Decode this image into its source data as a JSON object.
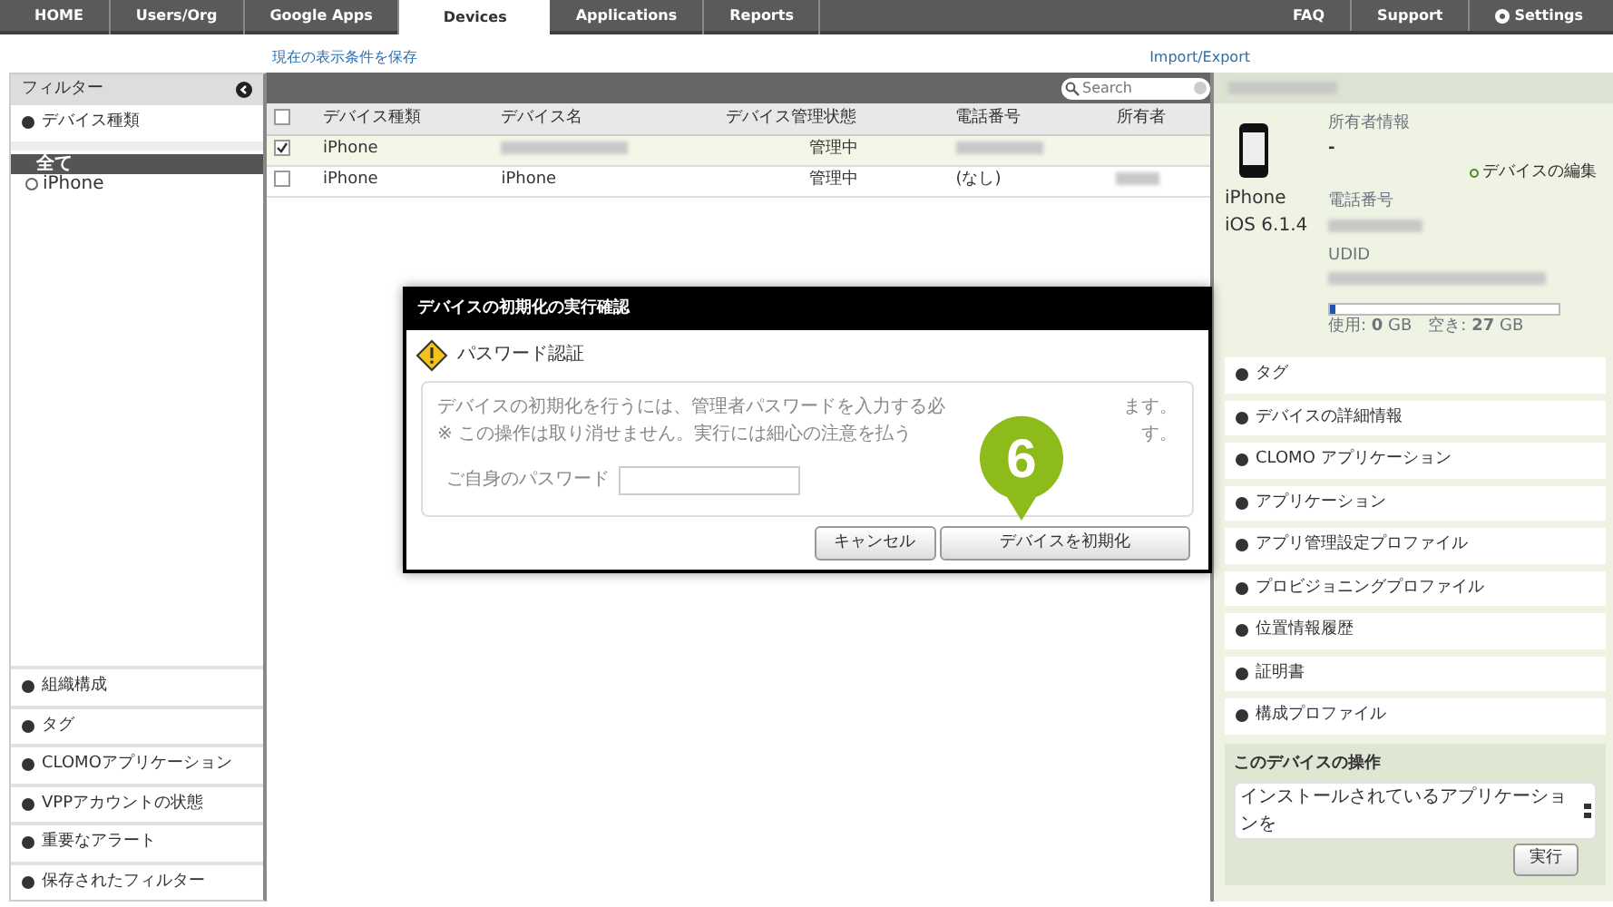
{
  "top_nav": {
    "tabs": [
      {
        "label": "HOME",
        "selected": false
      },
      {
        "label": "Users/Org",
        "selected": false
      },
      {
        "label": "Google Apps",
        "selected": false
      },
      {
        "label": "Devices",
        "selected": true
      },
      {
        "label": "Applications",
        "selected": false
      },
      {
        "label": "Reports",
        "selected": false
      }
    ],
    "right_links": [
      "FAQ",
      "Support",
      "Settings"
    ]
  },
  "links": {
    "save_filter": "現在の表示条件を保存",
    "import_export": "Import/Export"
  },
  "filter_panel": {
    "title": "フィルター",
    "section": "デバイス種類",
    "options": [
      {
        "label": "全て",
        "selected": true
      },
      {
        "label": "iPhone",
        "selected": false
      }
    ],
    "bottom_sections": [
      "組織構成",
      "タグ",
      "CLOMOアプリケーション",
      "VPPアカウントの状態",
      "重要なアラート",
      "保存されたフィルター"
    ]
  },
  "device_table": {
    "search_placeholder": "Search",
    "select_all_checked": false,
    "columns": [
      "デバイス種類",
      "デバイス名",
      "デバイス管理状態",
      "電話番号",
      "所有者"
    ],
    "rows": [
      {
        "checked": true,
        "selected": true,
        "cells": [
          "iPhone",
          {
            "blurred": true
          },
          "管理中",
          {
            "blurred": true
          },
          ""
        ]
      },
      {
        "checked": false,
        "selected": false,
        "cells": [
          "iPhone",
          "iPhone",
          "管理中",
          "(なし)",
          {
            "blurred": true
          }
        ]
      }
    ]
  },
  "dialog": {
    "title": "デバイスの初期化の実行確認",
    "heading": "パスワード認証",
    "message_lines": [
      [
        "デバイスの初期化を行うには、管理者パスワードを入力する必",
        "ます。"
      ],
      [
        "※ この操作は取り消せません。実行には細心の注意を払う",
        "す。"
      ]
    ],
    "password_label": "ご自身のパスワード",
    "buttons": [
      "キャンセル",
      "デバイスを初期化"
    ],
    "step_marker": "6"
  },
  "device_panel": {
    "model": "iPhone",
    "os": "iOS 6.1.4",
    "owner_label": "所有者情報",
    "owner_value": "-",
    "edit_link": "デバイスの編集",
    "phone_label": "電話番号",
    "udid_label": "UDID",
    "storage": {
      "level": 0.02,
      "text": "使用: **0** GB　空き: **27** GB"
    },
    "sections": [
      "タグ",
      "デバイスの詳細情報",
      "CLOMO アプリケーション",
      "アプリケーション",
      "アプリ管理設定プロファイル",
      "プロビジョニングプロファイル",
      "位置情報履歴",
      "証明書",
      "構成プロファイル"
    ],
    "operation": {
      "title": "このデバイスの操作",
      "select_value": "インストールされているアプリケーションを",
      "button": "実行"
    }
  }
}
